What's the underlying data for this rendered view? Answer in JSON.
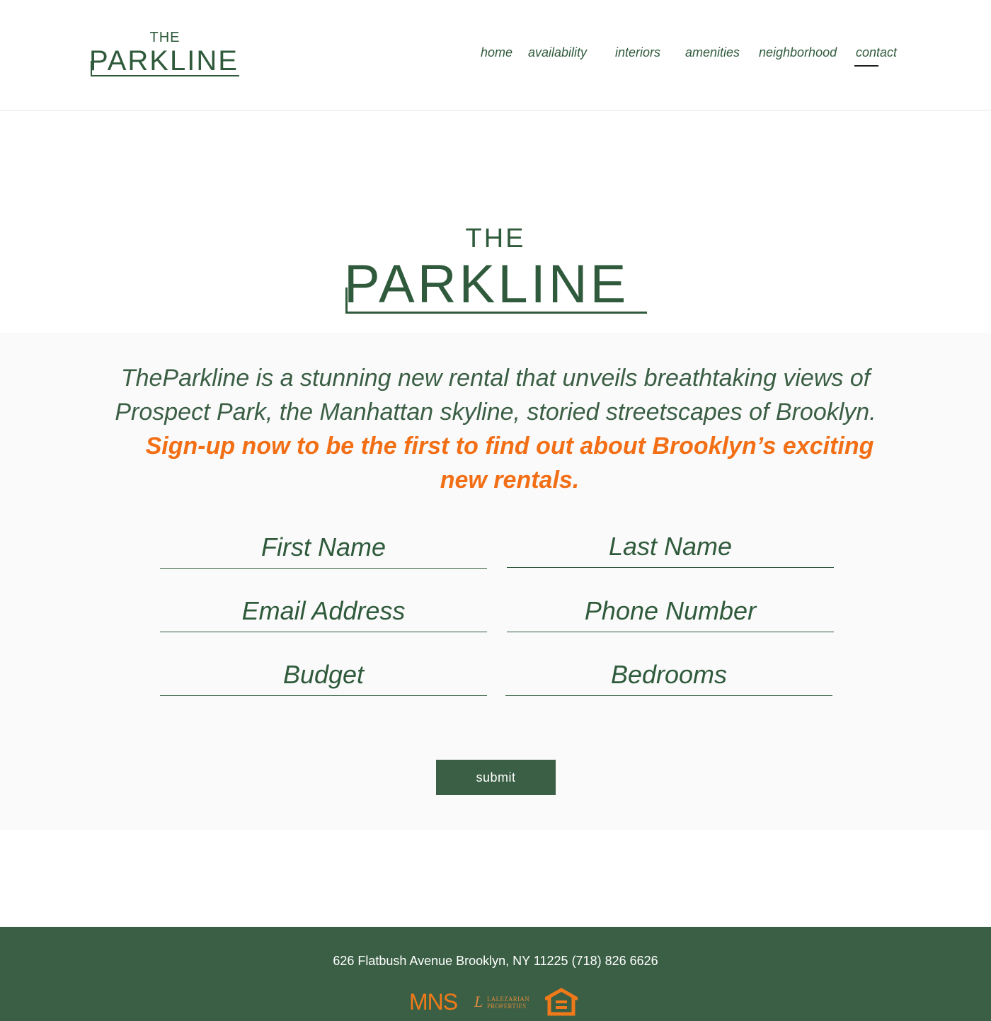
{
  "brand": {
    "logo_the": "THE",
    "logo_word": "PARKLINE"
  },
  "nav": {
    "items": [
      {
        "label": "home"
      },
      {
        "label": "availability"
      },
      {
        "label": "interiors"
      },
      {
        "label": "amenities"
      },
      {
        "label": "neighborhood"
      },
      {
        "label": "contact",
        "active": true
      }
    ]
  },
  "hero": {
    "logo_the": "THE",
    "logo_word": "PARKLINE"
  },
  "intro": {
    "description": "TheParkline is a stunning new rental that unveils breathtaking views of Prospect Park, the Manhattan skyline, storied streetscapes of Brooklyn.",
    "cta": "Sign-up now to be the first to find out about Brooklyn’s exciting new rentals."
  },
  "form": {
    "first_name_placeholder": "First Name",
    "last_name_placeholder": "Last Name",
    "email_placeholder": "Email Address",
    "phone_placeholder": "Phone Number",
    "budget_placeholder": "Budget",
    "bedrooms_placeholder": "Bedrooms",
    "submit_label": "submit"
  },
  "footer": {
    "address": "626 Flatbush Avenue Brooklyn, NY 11225 (718) 826 6626",
    "mns_logo": "MNS",
    "lalezarian_mark": "L",
    "lalezarian_line1": "LALEZARIAN",
    "lalezarian_line2": "PROPERTIES",
    "equal_housing_icon": "equal-housing-opportunity-icon"
  },
  "colors": {
    "brand_green": "#2f5a3b",
    "footer_green": "#3a5f44",
    "accent_orange": "#f26f16"
  }
}
